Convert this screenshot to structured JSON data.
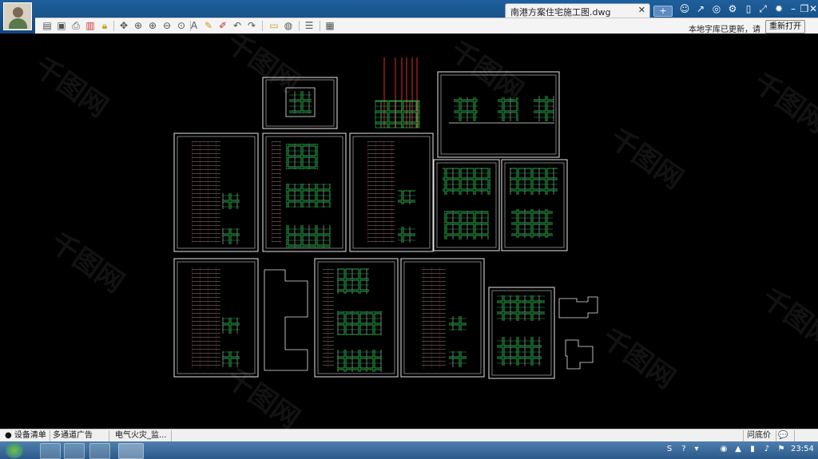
{
  "window": {
    "tab_title": "南港方案住宅施工图.dwg",
    "tab_close": "✕",
    "new_tab": "+"
  },
  "toolbar": {
    "status_text": "本地字库已更新，请",
    "reopen_label": "重新打开"
  },
  "doc_tabs": [
    {
      "label": "● 设备清单"
    },
    {
      "label": "多通道广告字..."
    },
    {
      "label": "电气火灾_监..."
    }
  ],
  "docbar_right": {
    "ask_label": "问底价",
    "chat_label": "💬"
  },
  "taskbar": {
    "clock": "23:54"
  },
  "watermark_text": "千图网",
  "colors": {
    "title_bar": "#1f5f9c",
    "canvas": "#000000",
    "drawing_green": "#2fd35a",
    "drawing_red": "#e02a2a",
    "drawing_white": "#e6e6e6"
  }
}
